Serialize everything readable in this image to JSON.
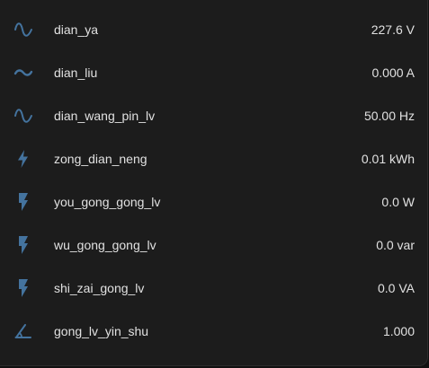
{
  "accent_color": "#44739e",
  "entities": [
    {
      "icon": "sine-wave-icon",
      "name": "dian_ya",
      "value": "227.6 V"
    },
    {
      "icon": "current-ac-icon",
      "name": "dian_liu",
      "value": "0.000 A"
    },
    {
      "icon": "sine-wave-icon",
      "name": "dian_wang_pin_lv",
      "value": "50.00 Hz"
    },
    {
      "icon": "lightning-bolt-icon",
      "name": "zong_dian_neng",
      "value": "0.01 kWh"
    },
    {
      "icon": "flash-icon",
      "name": "you_gong_gong_lv",
      "value": "0.0 W"
    },
    {
      "icon": "flash-icon",
      "name": "wu_gong_gong_lv",
      "value": "0.0 var"
    },
    {
      "icon": "flash-icon",
      "name": "shi_zai_gong_lv",
      "value": "0.0 VA"
    },
    {
      "icon": "angle-acute-icon",
      "name": "gong_lv_yin_shu",
      "value": "1.000"
    }
  ]
}
